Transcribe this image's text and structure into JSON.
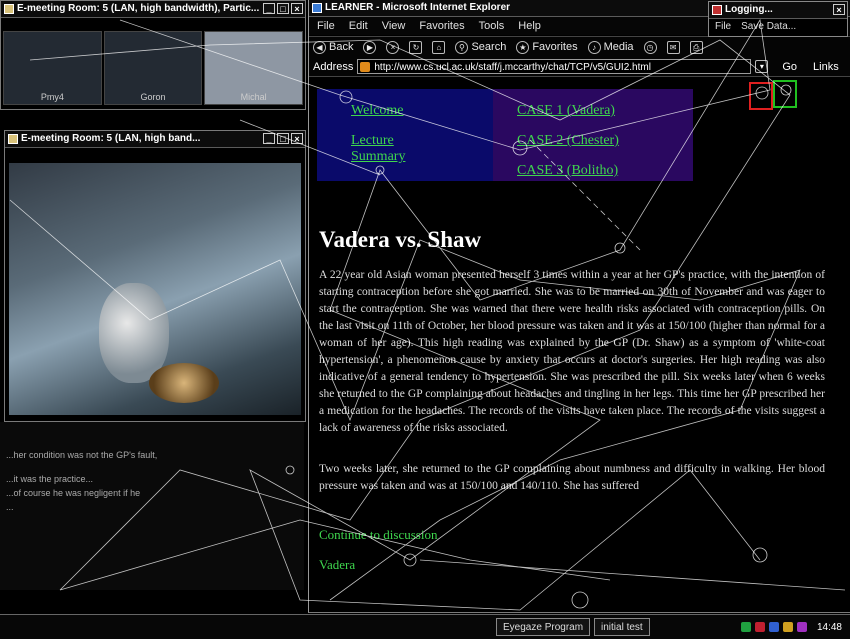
{
  "windows": {
    "meeting": {
      "title": "E-meeting Room: 5 (LAN, high bandwidth), Partic...",
      "thumbs": [
        "Pmy4",
        "Goron",
        "Michal"
      ]
    },
    "video": {
      "title": "E-meeting Room: 5 (LAN, high band..."
    },
    "logging": {
      "title": "Logging...",
      "menu": [
        "File",
        "Save Data..."
      ]
    }
  },
  "ie": {
    "title": "LEARNER - Microsoft Internet Explorer",
    "menu": [
      "File",
      "Edit",
      "View",
      "Favorites",
      "Tools",
      "Help"
    ],
    "toolbar": {
      "back": "Back",
      "search": "Search",
      "favorites": "Favorites",
      "media": "Media"
    },
    "address_label": "Address",
    "url": "http://www.cs.ucl.ac.uk/staff/j.mccarthy/chat/TCP/v5/GUI2.html",
    "go": "Go",
    "links": "Links"
  },
  "nav": {
    "welcome": "Welcome",
    "lecture_line1": "Lecture",
    "lecture_line2": "Summary",
    "case1": "CASE 1 (Vadera)",
    "case2": "CASE 2 (Chester)",
    "case3": "CASE 3 (Bolitho)"
  },
  "document": {
    "title": "Vadera vs. Shaw",
    "para1": "A 22 year old Asian woman presented herself 3 times within a year at her GP's practice, with the intention of starting contraception before she got married. She was to be married on 30th of November and was eager to start the contraception. She was warned that there were health risks associated with contraception pills. On the last visit on 11th of October, her blood pressure was taken and it was at 150/100 (higher than normal for a woman of her age). This high reading was explained by the GP (Dr. Shaw) as a symptom of 'white-coat hypertension', a phenomenon cause by anxiety that occurs at doctor's surgeries. Her high reading was also indicative of a general tendency to hypertension. She was prescribed the pill. Six weeks later when 6 weeks she returned to the GP complaining about headaches and tingling in her legs. This time her GP prescribed her a medication for the headaches. The records of the visits have taken place. The records of the visits suggest a lack of awareness of the risks associated.",
    "para2": "Two weeks later, she returned to the GP complaining about numbness and difficulty in walking. Her blood pressure was taken and was at 150/100 and 140/110. She has suffered",
    "green1": "Continue to discussion",
    "green2": "Vadera"
  },
  "chat": {
    "lines": [
      "...her condition was not the GP's fault,",
      "...it was the practice...",
      "...of course he was negligent if he",
      "..."
    ]
  },
  "taskbar": {
    "buttons": [
      "Eyegaze Program",
      "initial test"
    ],
    "clock": "14:48"
  },
  "colors": {
    "link_green": "#3fd74e",
    "nav_blue": "#0a0a6a",
    "nav_purple": "#2a0860",
    "marker_red": "#e02020",
    "marker_green": "#20c020"
  }
}
